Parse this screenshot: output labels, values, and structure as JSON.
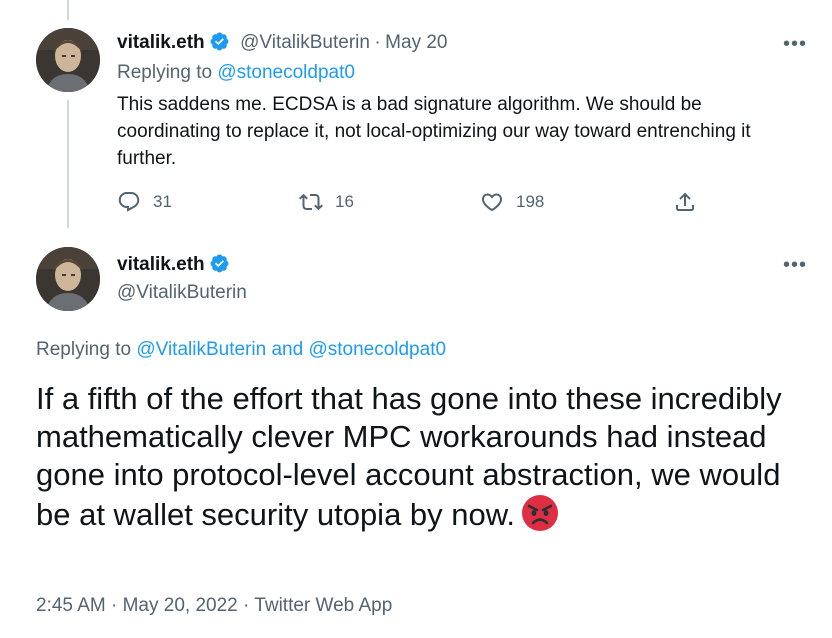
{
  "tweet1": {
    "display_name": "vitalik.eth",
    "handle": "@VitalikButerin",
    "separator": "·",
    "date": "May 20",
    "replying_prefix": "Replying to ",
    "replying_to": "@stonecoldpat0",
    "text": "This saddens me. ECDSA is a bad signature algorithm. We should be coordinating to replace it, not local-optimizing our way toward entrenching it further.",
    "more": "•••",
    "replies": "31",
    "retweets": "16",
    "likes": "198"
  },
  "tweet2": {
    "display_name": "vitalik.eth",
    "handle": "@VitalikButerin",
    "more": "•••",
    "replying_prefix": "Replying to ",
    "replying_to_1": "@VitalikButerin",
    "replying_and": " and ",
    "replying_to_2": "@stonecoldpat0",
    "text": "If a fifth of the effort that has gone into these incredibly mathematically clever MPC workarounds had instead gone into protocol-level account abstraction, we would be at wallet security utopia by now.",
    "emoji": "angry-face",
    "time": "2:45 AM",
    "meta_sep": " · ",
    "date": "May 20, 2022",
    "source": "Twitter Web App"
  },
  "colors": {
    "accent": "#1d9bf0",
    "muted": "#536471",
    "text": "#0f1419",
    "divider": "#cfd9de"
  }
}
